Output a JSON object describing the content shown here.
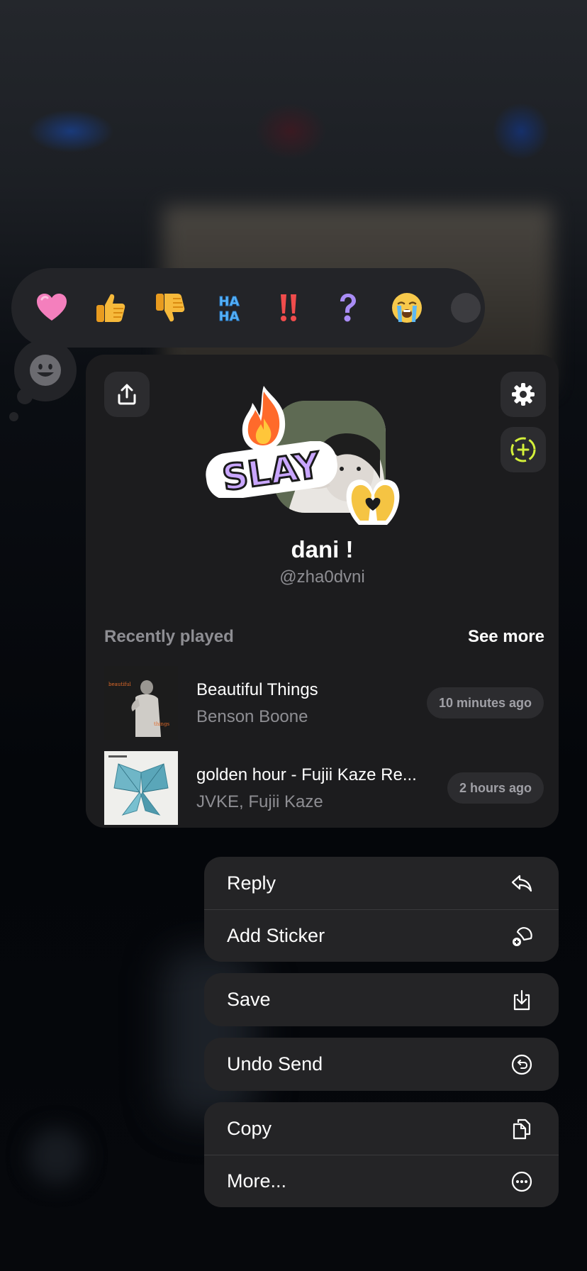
{
  "reactions": [
    {
      "icon": "pink-heart-icon"
    },
    {
      "icon": "thumbs-up-icon"
    },
    {
      "icon": "thumbs-down-icon"
    },
    {
      "icon": "haha-icon",
      "text": "HA HA"
    },
    {
      "icon": "double-exclamation-icon",
      "text": "!!"
    },
    {
      "icon": "question-mark-icon",
      "text": "?"
    },
    {
      "icon": "loudly-crying-face-icon"
    }
  ],
  "profile": {
    "name": "dani !",
    "handle": "@zha0dvni",
    "sticker_text": "SLAY"
  },
  "recently_played": {
    "title": "Recently played",
    "see_more": "See more",
    "tracks": [
      {
        "title": "Beautiful Things",
        "artist": "Benson Boone",
        "time": "10 minutes ago",
        "cover_text": "beautiful things"
      },
      {
        "title": "golden hour - Fujii Kaze Re...",
        "artist": "JVKE, Fujii Kaze",
        "time": "2 hours ago"
      }
    ]
  },
  "menu": {
    "group1": [
      {
        "label": "Reply",
        "icon": "reply-arrow-icon"
      },
      {
        "label": "Add Sticker",
        "icon": "add-sticker-icon"
      }
    ],
    "save": {
      "label": "Save",
      "icon": "save-download-icon"
    },
    "undo_send": {
      "label": "Undo Send",
      "icon": "undo-icon"
    },
    "group2": [
      {
        "label": "Copy",
        "icon": "copy-icon"
      },
      {
        "label": "More...",
        "icon": "more-ellipsis-icon"
      }
    ]
  },
  "colors": {
    "card_bg": "#1c1c1e",
    "menu_bg": "#242426",
    "accent_lime": "#d4f03a",
    "secondary_text": "#8e8e93"
  }
}
